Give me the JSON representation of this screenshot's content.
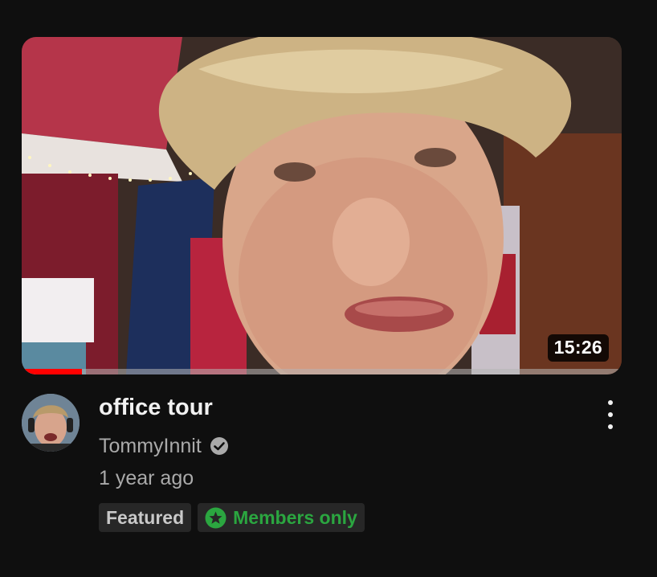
{
  "video": {
    "title": "office tour",
    "channel": "TommyInnit",
    "age": "1 year ago",
    "duration": "15:26",
    "watch_progress": 0.1
  },
  "badges": {
    "featured": "Featured",
    "members": "Members only"
  },
  "colors": {
    "background": "#0f0f0f",
    "progress": "#ff0000",
    "members_green": "#2ba640"
  }
}
